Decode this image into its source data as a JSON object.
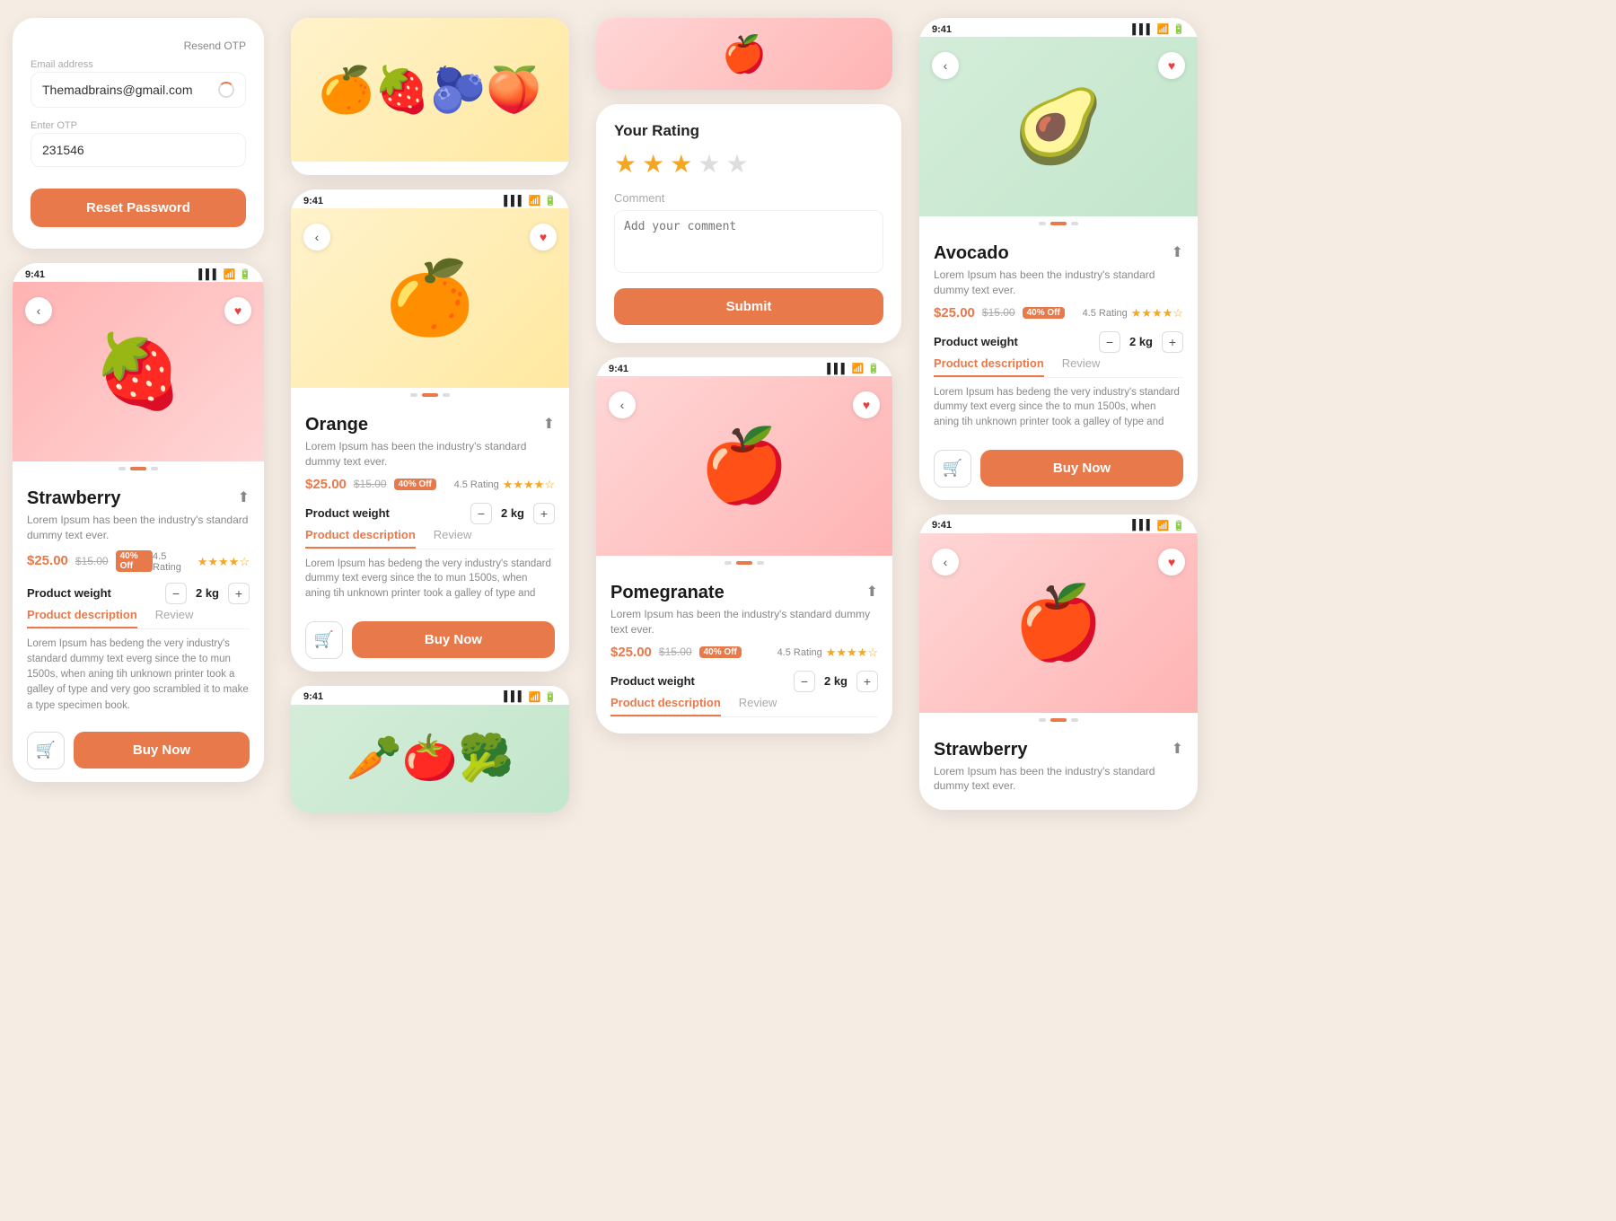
{
  "auth": {
    "resend_otp": "Resend OTP",
    "email_label": "Email address",
    "email_value": "Themadbrains@gmail.com",
    "otp_label": "Enter OTP",
    "otp_value": "231546",
    "reset_btn": "Reset Password"
  },
  "strawberry": {
    "time": "9:41",
    "name": "Strawberry",
    "desc": "Lorem Ipsum has been the industry's standard dummy text ever.",
    "price_now": "$25.00",
    "price_old": "$15.00",
    "discount": "40% Off",
    "rating_label": "4.5 Rating",
    "weight_label": "Product weight",
    "weight_value": "2 kg",
    "tab_desc": "Product description",
    "tab_review": "Review",
    "desc_long": "Lorem Ipsum has bedeng the very industry's standard dummy text everg since the to mun 1500s, when aning tih unknown printer took a galley of type and very goo scrambled it to make a type specimen book.",
    "buy_btn": "Buy Now"
  },
  "orange": {
    "time": "9:41",
    "name": "Orange",
    "desc": "Lorem Ipsum has been the industry's standard dummy text ever.",
    "price_now": "$25.00",
    "price_old": "$15.00",
    "discount": "40% Off",
    "rating_label": "4.5 Rating",
    "weight_label": "Product weight",
    "weight_value": "2 kg",
    "tab_desc": "Product description",
    "tab_review": "Review",
    "desc_long": "Lorem Ipsum has bedeng the very industry's standard dummy text everg since the to mun 1500s, when aning tih unknown printer took a galley of type and very goo scrambled it to make a type specimen book.",
    "buy_btn": "Buy Now"
  },
  "pomegranate": {
    "time": "9:41",
    "name": "Pomegranate",
    "desc": "Lorem Ipsum has been the industry's standard dummy text ever.",
    "price_now": "$25.00",
    "price_old": "$15.00",
    "discount": "40% Off",
    "rating_label": "4.5 Rating",
    "weight_label": "Product weight",
    "weight_value": "2 kg",
    "tab_desc": "Product description",
    "tab_review": "Review"
  },
  "avocado": {
    "time": "9:41",
    "name": "Avocado",
    "desc": "Lorem Ipsum has been the industry's standard dummy text ever.",
    "price_now": "$25.00",
    "price_old": "$15.00",
    "discount": "40% Off",
    "rating_label": "4.5 Rating",
    "weight_label": "Product weight",
    "weight_value": "2 kg",
    "tab_desc": "Product description",
    "tab_review": "Review",
    "desc_long": "Lorem Ipsum has bedeng the very industry's standard dummy text everg since the to mun 1500s, when aning tih unknown printer took a galley of type and very goo scrambled it to",
    "buy_btn": "Buy Now"
  },
  "apple": {
    "time": "9:41",
    "name": "Strawberry",
    "desc": "Lorem Ipsum has been the industry's standard dummy text ever."
  },
  "rating": {
    "title": "Your Rating",
    "comment_label": "Comment",
    "comment_placeholder": "Add your comment",
    "submit_btn": "Submit",
    "stars": 3,
    "total_stars": 5
  },
  "colors": {
    "orange": "#e8794a",
    "star": "#f5a623",
    "bg": "#f5ece4"
  }
}
